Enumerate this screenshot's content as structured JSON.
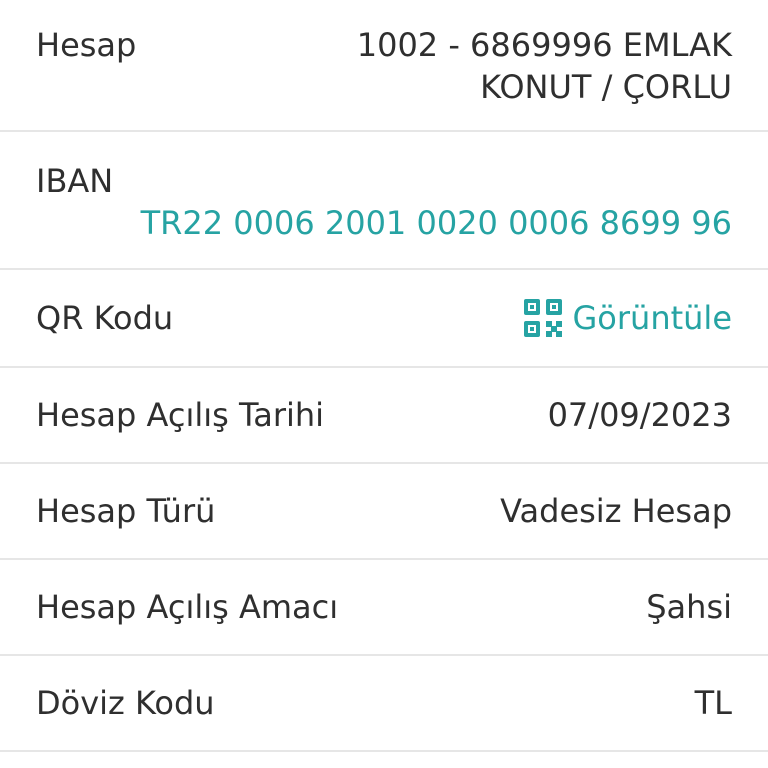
{
  "account": {
    "label": "Hesap",
    "value_line1": "1002 - 6869996 EMLAK",
    "value_line2": "KONUT / ÇORLU"
  },
  "iban": {
    "label": "IBAN",
    "value": "TR22 0006 2001 0020 0006 8699 96"
  },
  "qr": {
    "label": "QR Kodu",
    "link_label": "Görüntüle",
    "icon": "qr-code-icon"
  },
  "opening_date": {
    "label": "Hesap Açılış Tarihi",
    "value": "07/09/2023"
  },
  "account_type": {
    "label": "Hesap Türü",
    "value": "Vadesiz Hesap"
  },
  "opening_purpose": {
    "label": "Hesap Açılış Amacı",
    "value": "Şahsi"
  },
  "currency": {
    "label": "Döviz Kodu",
    "value": "TL"
  },
  "colors": {
    "accent": "#26a3a3",
    "text": "#2f2f2f",
    "divider": "#e6e6e6"
  }
}
